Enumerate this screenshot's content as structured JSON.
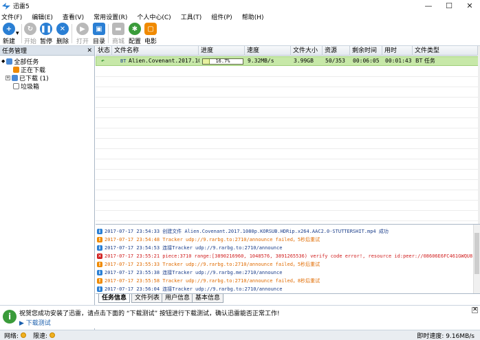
{
  "window": {
    "title": "迅雷5",
    "minimize": "—",
    "maximize": "☐",
    "close": "✕"
  },
  "menu": [
    "文件(F)",
    "编辑(E)",
    "查看(V)",
    "常用设置(R)",
    "个人中心(C)",
    "工具(T)",
    "组件(P)",
    "帮助(H)"
  ],
  "toolbar": {
    "new": "新建",
    "start": "开始",
    "pause": "暂停",
    "delete": "删除",
    "open": "打开",
    "dir": "目录",
    "commercial": "商城",
    "config": "配置",
    "movie": "电影"
  },
  "sidebar": {
    "title": "任务管理",
    "close": "✕",
    "all_tasks": "全部任务",
    "downloading": "正在下载",
    "downloaded": "已下载 (1)",
    "trash": "垃圾箱"
  },
  "columns": [
    "状态",
    "文件名称",
    "进度",
    "速度",
    "文件大小",
    "资源",
    "剩余时间",
    "用时",
    "文件类型"
  ],
  "task": {
    "icon_type": "BT",
    "file_name": "Alien.Covenant.2017.1080p",
    "progress_text": "16.7%",
    "progress_fraction": 0.167,
    "speed": "9.32MB/s",
    "size": "3.99GB",
    "resources": "50/353",
    "remaining": "00:06:05",
    "elapsed": "00:01:43",
    "type": "BT 任务"
  },
  "log": [
    {
      "kind": "info",
      "text": "2017-07-17 23:54:33 创建文件 Alien.Covenant.2017.1080p.KORSUB.HDRip.x264.AAC2.0-STUTTERSHIT.mp4 成功",
      "color": "#1b3e8a"
    },
    {
      "kind": "warn",
      "text": "2017-07-17 23:54:48 Tracker udp://9.rarbg.to:2710/announce failed，5秒后重试",
      "color": "#e06b00"
    },
    {
      "kind": "info",
      "text": "2017-07-17 23:54:53 连接Tracker udp://9.rarbg.to:2710/announce",
      "color": "#1b3e8a"
    },
    {
      "kind": "error",
      "text": "2017-07-17 23:55:21 piece:3710 range:[3890216960, 1048576, 3891265536)  verify code error!, resource id:peer://08606E6FC461GWQU819...",
      "color": "#d01e1e"
    },
    {
      "kind": "warn",
      "text": "2017-07-17 23:55:33 Tracker udp://9.rarbg.to:2710/announce failed，5秒后重试",
      "color": "#e06b00"
    },
    {
      "kind": "info",
      "text": "2017-07-17 23:55:38 连接Tracker udp://9.rarbg.me:2710/announce",
      "color": "#1b3e8a"
    },
    {
      "kind": "warn",
      "text": "2017-07-17 23:55:58 Tracker udp://9.rarbg.to:2710/announce failed，8秒后重试",
      "color": "#e06b00"
    },
    {
      "kind": "info",
      "text": "2017-07-17 23:56:04 连接Tracker udp://9.rarbg.to:2710/announce",
      "color": "#1b3e8a"
    }
  ],
  "log_tabs": [
    "任务信息",
    "文件列表",
    "用户信息",
    "基本信息"
  ],
  "notice": {
    "text": "祝贺您成功安装了迅雷，请点击下面的 “下载测试” 按钮进行下载测试，确认迅雷能否正常工作!",
    "link": "下载测试",
    "close": "✕"
  },
  "status": {
    "network_label": "网络:",
    "speed_limit_label": "限速:",
    "realtime_speed": "即时速度: 9.16MB/s"
  },
  "colors": {
    "row_selected": "#c7e8a8",
    "accent": "#2a7fd4",
    "log_info": "#1b3e8a",
    "log_warn": "#e06b00",
    "log_error": "#d01e1e"
  }
}
